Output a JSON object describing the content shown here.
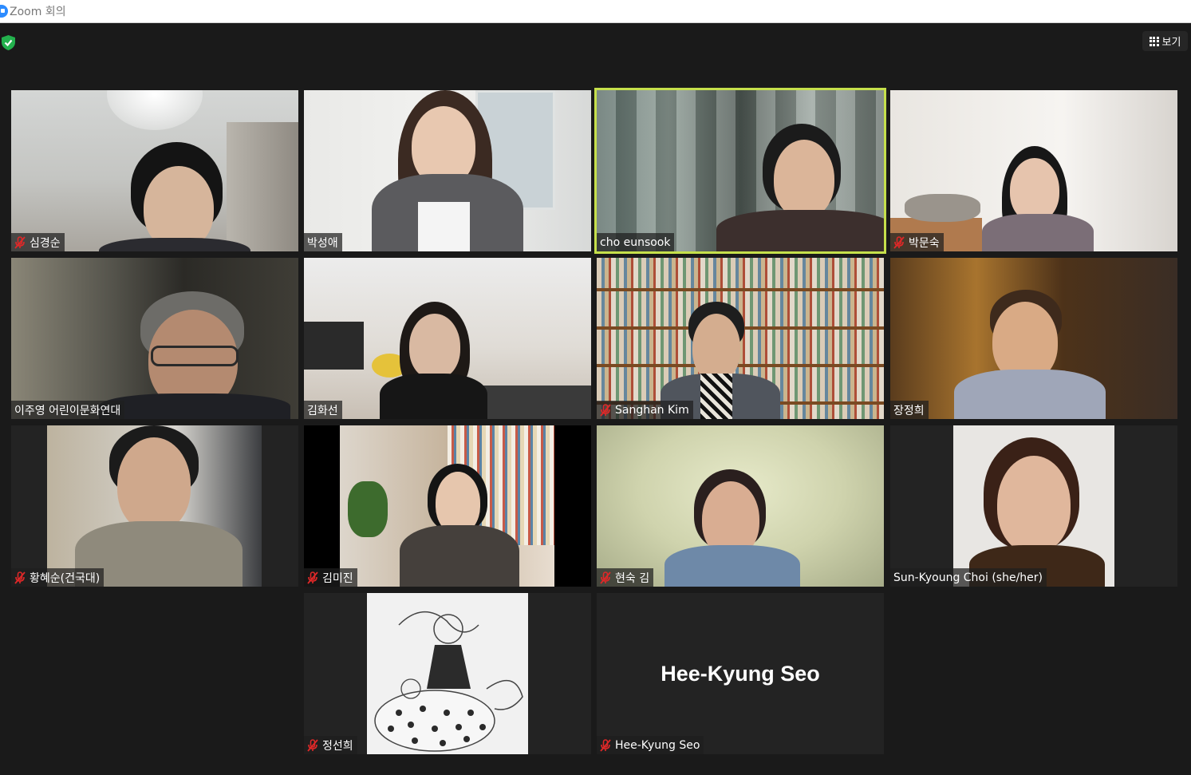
{
  "window": {
    "title": "Zoom 회의"
  },
  "toolbar": {
    "view_label": "보기"
  },
  "participants": [
    {
      "name": "심경순",
      "muted": true
    },
    {
      "name": "박성애",
      "muted": false
    },
    {
      "name": "cho eunsook",
      "muted": false,
      "active_speaker": true
    },
    {
      "name": "박문숙",
      "muted": true
    },
    {
      "name": "이주영 어린이문화연대",
      "muted": false
    },
    {
      "name": "김화선",
      "muted": false
    },
    {
      "name": "Sanghan Kim",
      "muted": true
    },
    {
      "name": "장정희",
      "muted": false
    },
    {
      "name": "황혜순(건국대)",
      "muted": true
    },
    {
      "name": "김미진",
      "muted": true
    },
    {
      "name": "현숙 김",
      "muted": true
    },
    {
      "name": "Sun-Kyoung Choi (she/her)",
      "muted": false
    },
    {
      "name": "정선희",
      "muted": true
    },
    {
      "name": "Hee-Kyung Seo",
      "muted": true,
      "video_off": true,
      "display_name": "Hee-Kyung Seo"
    }
  ],
  "colors": {
    "active_border": "#c6e04b",
    "muted_icon": "#e02828",
    "background": "#1a1a1a",
    "security_shield": "#23b14d"
  }
}
